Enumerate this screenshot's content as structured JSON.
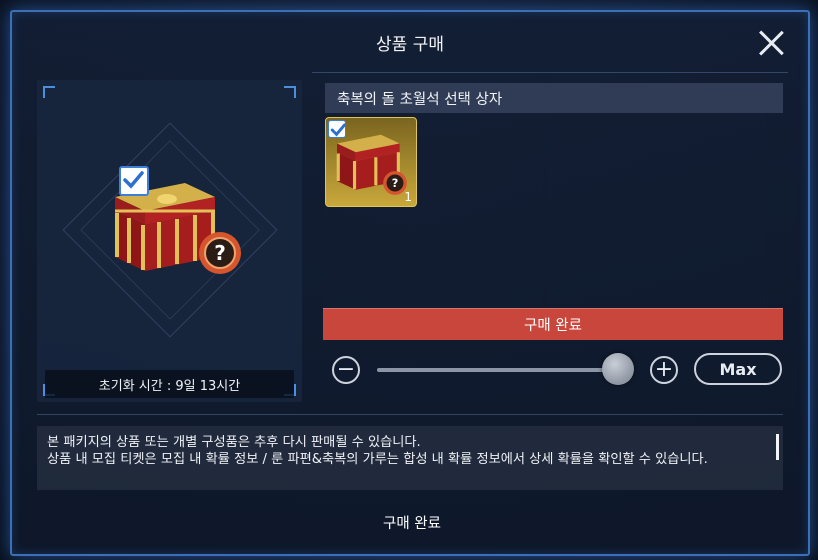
{
  "dialog": {
    "title": "상품 구매",
    "close_icon": "close-x-icon"
  },
  "preview": {
    "item_icon": "treasure-chest-icon",
    "badge_icon": "question-mark-badge-icon",
    "reset_time_label": "초기화 시간 : 9일 13시간"
  },
  "item": {
    "name": "축복의 돌 초월석 선택 상자",
    "slot_count": "1"
  },
  "purchase": {
    "confirm_bar_label": "구매 완료",
    "minus_icon": "minus-icon",
    "plus_icon": "plus-icon",
    "max_label": "Max",
    "quantity_fraction": 1.0
  },
  "notice": {
    "text": "본 패키지의 상품 또는 개별 구성품은 추후 다시 판매될 수 있습니다.\n상품 내 모집 티켓은 모집 내 확률 정보 / 룬 파편&축복의 가루는 합성 내 확률 정보에서 상세 확률을 확인할 수 있습니다."
  },
  "footer": {
    "confirm_label": "구매 완료"
  },
  "colors": {
    "accent_blue": "#3b6fb6",
    "confirm_red": "#c9463c",
    "slot_gold": "#c9a83a"
  }
}
